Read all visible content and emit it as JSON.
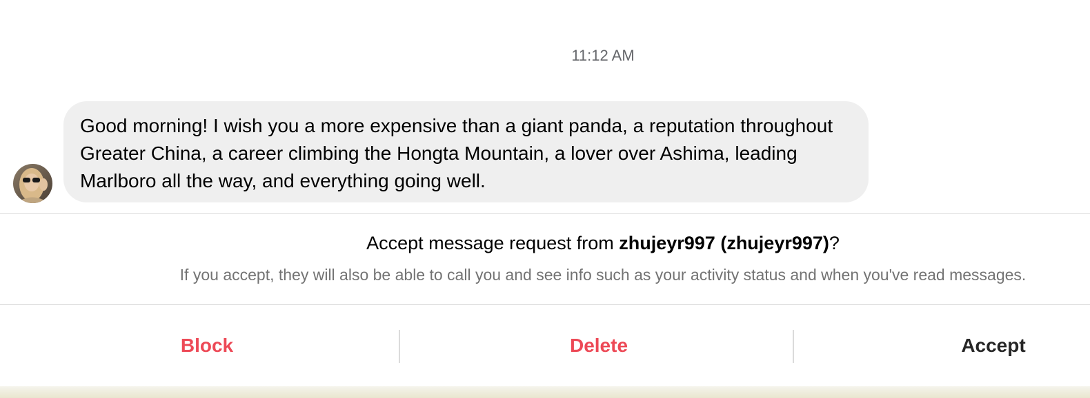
{
  "thread": {
    "timestamp": "11:12 AM",
    "message": {
      "text": "Good morning! I wish you a more expensive than a giant panda, a reputation throughout Greater China, a career climbing the Hongta Mountain, a lover over Ashima, leading Marlboro all the way, and everything going well."
    },
    "avatar_icon": "user-avatar"
  },
  "request": {
    "title_prefix": "Accept message request from ",
    "username": "zhujeyr997 (zhujeyr997)",
    "title_suffix": "?",
    "subtitle": "If you accept, they will also be able to call you and see info such as your activity status and when you've read messages."
  },
  "actions": {
    "block_label": "Block",
    "delete_label": "Delete",
    "accept_label": "Accept"
  },
  "colors": {
    "danger": "#ed4956",
    "bubble": "#efefef",
    "divider": "#dbdbdb",
    "muted": "#737373"
  }
}
